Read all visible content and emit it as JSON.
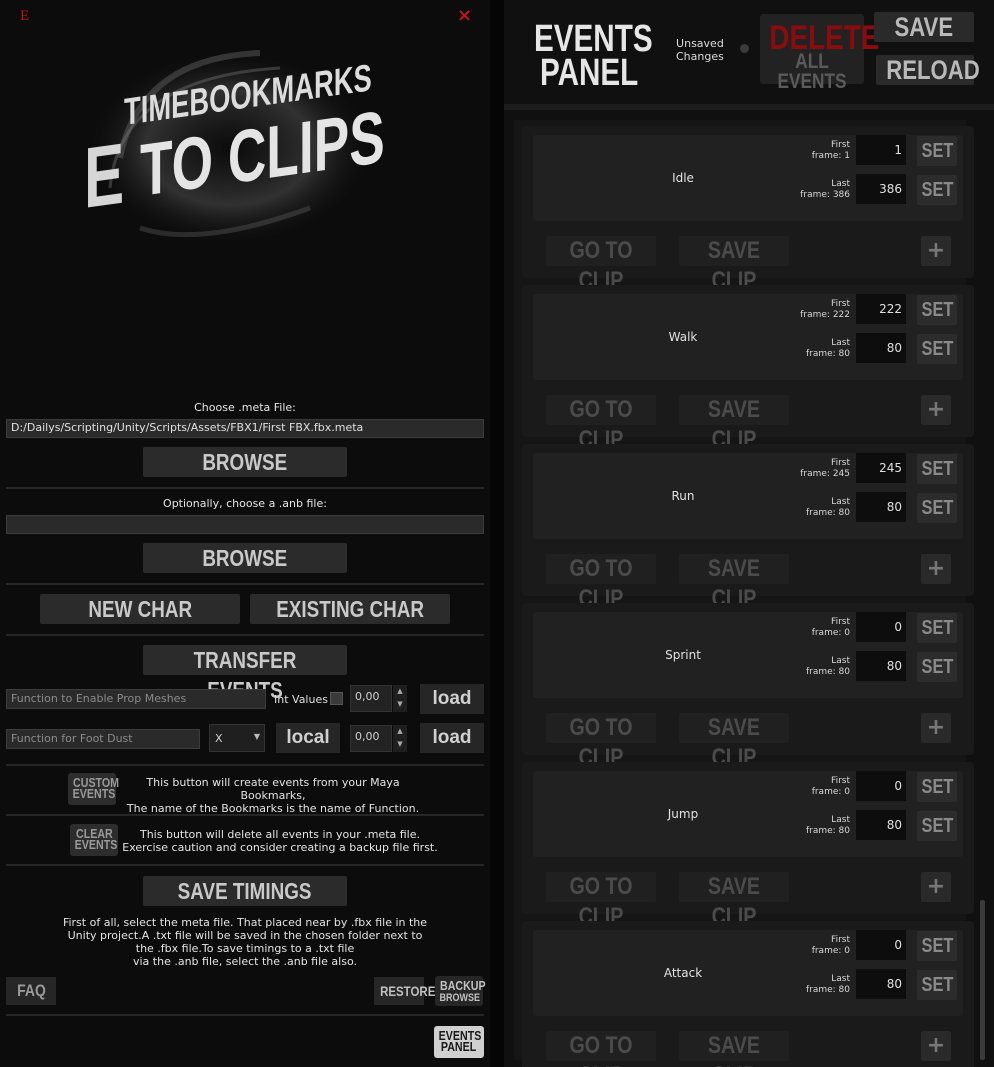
{
  "window": {
    "app_icon_glyph": "E",
    "close_glyph": "×"
  },
  "logo": {
    "line1": "TIMEBOOKMARKS",
    "line2": "TO CLIPS",
    "prefix": "E"
  },
  "meta_section": {
    "label": "Choose .meta File:",
    "path": "D:/Dailys/Scripting/Unity/Scripts/Assets/FBX1/First FBX.fbx.meta",
    "browse_label": "BROWSE"
  },
  "anb_section": {
    "label": "Optionally, choose a .anb file:",
    "path": "",
    "browse_label": "BROWSE"
  },
  "char_buttons": {
    "new_char": "NEW CHAR",
    "existing_char": "EXISTING CHAR"
  },
  "transfer": {
    "label": "TRANSFER EVENTS"
  },
  "prop_row": {
    "placeholder": "Function to Enable Prop Meshes",
    "int_values_label": "Int Values",
    "value": "0,00",
    "load_label": "load"
  },
  "dust_row": {
    "placeholder": "Function for Foot Dust",
    "axis_value": "X",
    "space_label": "local",
    "value": "0,00",
    "load_label": "load"
  },
  "custom_events": {
    "icon_line1": "CUSTOM",
    "icon_line2": "EVENTS",
    "text_line1": "This button will create events from your Maya Bookmarks,",
    "text_line2": "The name of the Bookmarks is the name of Function."
  },
  "clear_events": {
    "icon_line1": "CLEAR",
    "icon_line2": "EVENTS",
    "text_line1": "This button will delete all events in your .meta file.",
    "text_line2": "Exercise caution and consider creating a backup file first."
  },
  "timings": {
    "label": "SAVE TIMINGS",
    "text_line1": "First of all, select the meta file. That placed near by .fbx file in the",
    "text_line2": "Unity project.A .txt file will be saved in the chosen folder next to",
    "text_line3": "the .fbx file.To save timings to a .txt file",
    "text_line4": "via the .anb file, select the .anb file also."
  },
  "footer": {
    "faq": "FAQ",
    "restore": "RESTORE",
    "backup_line1": "BACKUP",
    "backup_line2": "BROWSE",
    "events_panel_line1": "EVENTS",
    "events_panel_line2": "PANEL"
  },
  "right_header": {
    "logo_line1": "EVENTS",
    "logo_line2": "PANEL",
    "unsaved_line1": "Unsaved",
    "unsaved_line2": "Changes",
    "delete_line1": "DELETE",
    "delete_line2": "ALL EVENTS",
    "save": "SAVE",
    "reload": "RELOAD"
  },
  "clip_labels": {
    "first": "First",
    "last": "Last",
    "set": "SET",
    "go_to_clip": "GO TO CLIP",
    "save_clip": "SAVE CLIP",
    "plus": "+"
  },
  "clips": [
    {
      "name": "Idle",
      "first_caption": "frame: 1",
      "first_value": "1",
      "last_caption": "frame: 386",
      "last_value": "386"
    },
    {
      "name": "Walk",
      "first_caption": "frame: 222",
      "first_value": "222",
      "last_caption": "frame: 80",
      "last_value": "80"
    },
    {
      "name": "Run",
      "first_caption": "frame: 245",
      "first_value": "245",
      "last_caption": "frame: 80",
      "last_value": "80"
    },
    {
      "name": "Sprint",
      "first_caption": "frame: 0",
      "first_value": "0",
      "last_caption": "frame: 80",
      "last_value": "80"
    },
    {
      "name": "Jump",
      "first_caption": "frame: 0",
      "first_value": "0",
      "last_caption": "frame: 80",
      "last_value": "80"
    },
    {
      "name": "Attack",
      "first_caption": "frame: 0",
      "first_value": "0",
      "last_caption": "frame: 80",
      "last_value": "80"
    }
  ],
  "colors": {
    "accent_red": "#c11515",
    "delete_red": "#8a0c0c",
    "background": "#0c0c0c"
  }
}
